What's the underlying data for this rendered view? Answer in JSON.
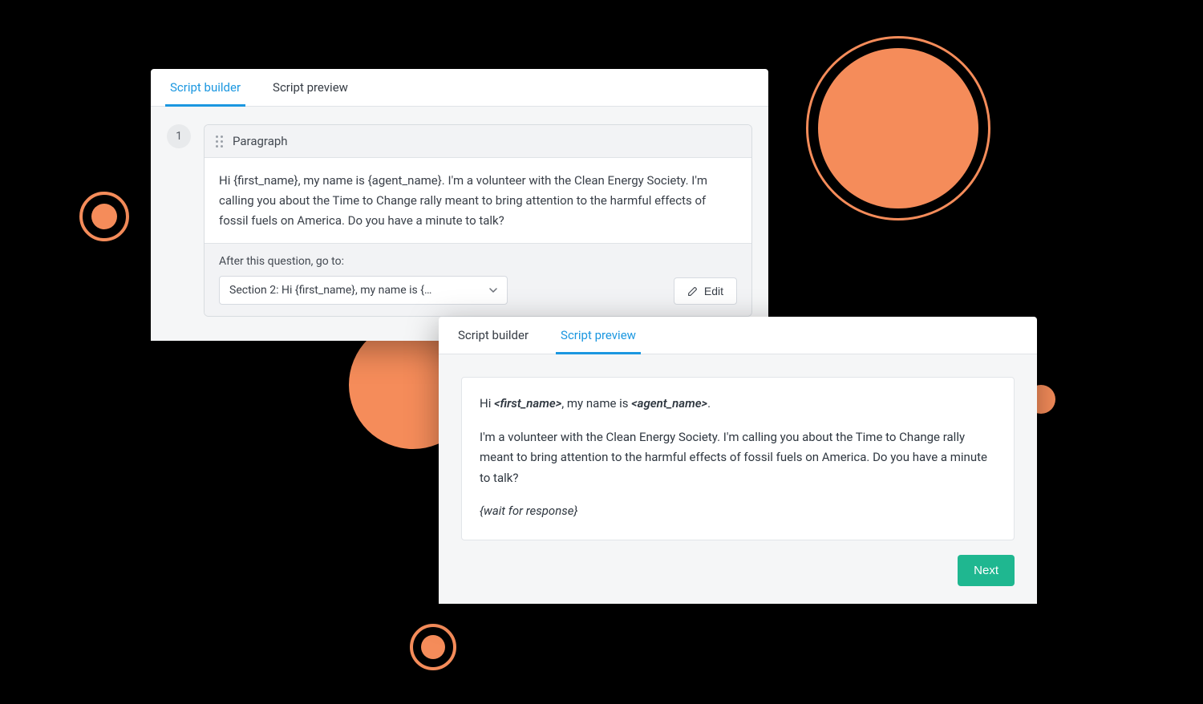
{
  "card1": {
    "tabs": {
      "builder": "Script builder",
      "preview": "Script preview"
    },
    "step_number": "1",
    "block_type_label": "Paragraph",
    "paragraph_text": "Hi {first_name}, my name is {agent_name}. I'm a volunteer with the Clean Energy Society. I'm calling you about the Time to Change rally meant to bring attention to the harmful effects of fossil fuels on America. Do you have a minute to talk?",
    "footer_label": "After this question, go to:",
    "select_value": "Section 2: Hi {first_name}, my name is {…",
    "edit_label": "Edit"
  },
  "card2": {
    "tabs": {
      "builder": "Script builder",
      "preview": "Script preview"
    },
    "line1_pre": "Hi ",
    "line1_var1": "<first_name>",
    "line1_mid": ", my name is ",
    "line1_var2": "<agent_name>",
    "line1_post": ".",
    "line2": "I'm a volunteer with the Clean Energy Society. I'm calling you about the Time to Change rally meant to bring attention to the harmful effects of fossil fuels on America. Do you have a minute to talk?",
    "line3": "{wait for response}",
    "next_label": "Next"
  }
}
